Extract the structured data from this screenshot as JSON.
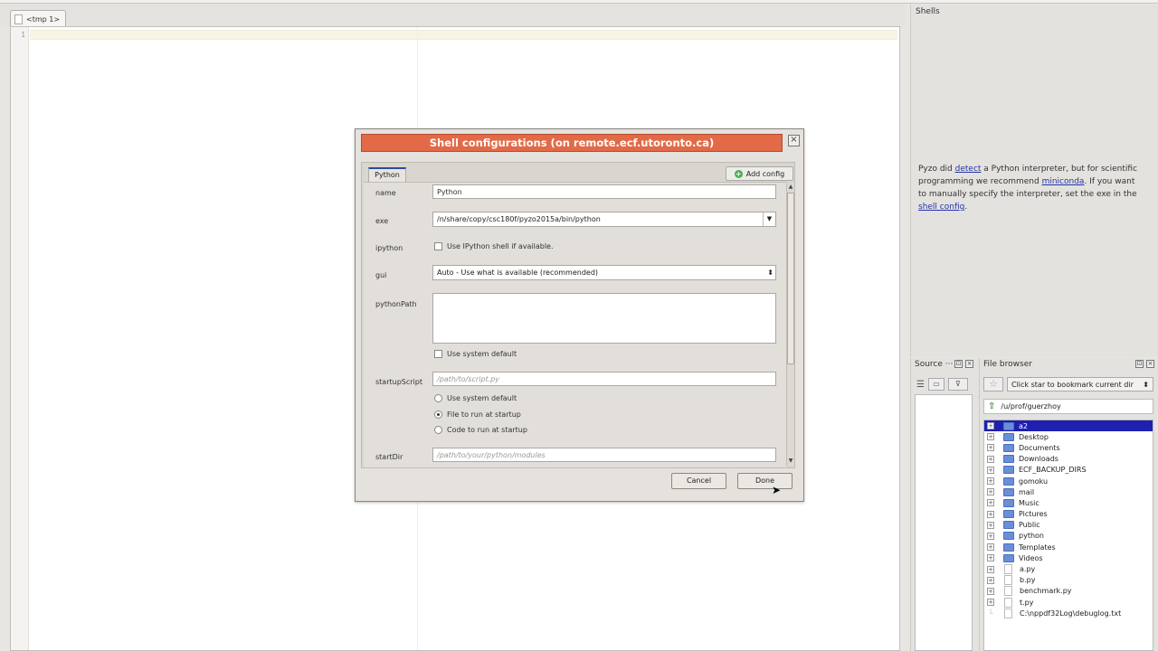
{
  "editor": {
    "tab_label": "<tmp 1>",
    "line_number": "1"
  },
  "shells": {
    "title": "Shells",
    "msg_pre1": "Pyzo did ",
    "link_detect": "detect",
    "msg_mid1": " a Python interpreter, but for scientific programming we recommend ",
    "link_miniconda": "miniconda",
    "msg_mid2": ". If you want to manually specify the interpreter, set the exe in the ",
    "link_shell_config": "shell config",
    "msg_end": "."
  },
  "source": {
    "title": "Source ···"
  },
  "file_browser": {
    "title": "File browser",
    "bookmark_placeholder": "Click star to bookmark current dir",
    "path": "/u/prof/guerzhoy",
    "items": [
      {
        "label": "a2",
        "type": "folder",
        "selected": true
      },
      {
        "label": "Desktop",
        "type": "folder"
      },
      {
        "label": "Documents",
        "type": "folder"
      },
      {
        "label": "Downloads",
        "type": "folder"
      },
      {
        "label": "ECF_BACKUP_DIRS",
        "type": "folder"
      },
      {
        "label": "gomoku",
        "type": "folder"
      },
      {
        "label": "mail",
        "type": "folder"
      },
      {
        "label": "Music",
        "type": "folder"
      },
      {
        "label": "Pictures",
        "type": "folder"
      },
      {
        "label": "Public",
        "type": "folder"
      },
      {
        "label": "python",
        "type": "folder"
      },
      {
        "label": "Templates",
        "type": "folder"
      },
      {
        "label": "Videos",
        "type": "folder"
      },
      {
        "label": "a.py",
        "type": "file"
      },
      {
        "label": "b.py",
        "type": "file"
      },
      {
        "label": "benchmark.py",
        "type": "file"
      },
      {
        "label": "t.py",
        "type": "file"
      },
      {
        "label": "C:\\nppdf32Log\\debuglog.txt",
        "type": "file-noexp"
      }
    ]
  },
  "dialog": {
    "title": "Shell configurations (on remote.ecf.utoronto.ca)",
    "close": "☒",
    "tab": "Python",
    "add_config": "Add config",
    "fields": {
      "name_label": "name",
      "name_value": "Python",
      "exe_label": "exe",
      "exe_value": "/n/share/copy/csc180f/pyzo2015a/bin/python",
      "ipython_label": "ipython",
      "ipython_check": "Use IPython shell if available.",
      "gui_label": "gui",
      "gui_value": "Auto  -  Use what is available (recommended)",
      "pythonpath_label": "pythonPath",
      "pythonpath_check": "Use system default",
      "startup_label": "startupScript",
      "startup_placeholder": "/path/to/script.py",
      "startup_opt1": "Use system default",
      "startup_opt2": "File to run at startup",
      "startup_opt3": "Code to run at startup",
      "startdir_label": "startDir",
      "startdir_placeholder": "/path/to/your/python/modules"
    },
    "cancel": "Cancel",
    "done": "Done"
  }
}
